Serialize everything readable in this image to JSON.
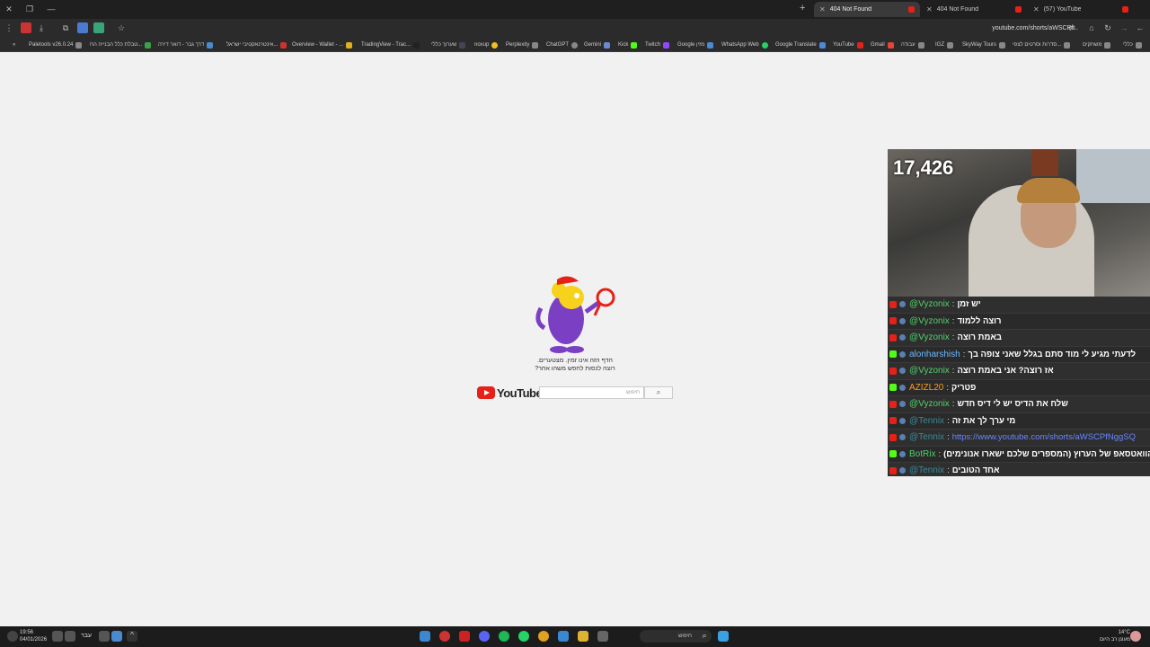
{
  "browser": {
    "tabs": [
      {
        "title": "404 Not Found",
        "active": true
      },
      {
        "title": "404 Not Found",
        "active": false
      },
      {
        "title": "(57) YouTube",
        "active": false
      }
    ],
    "url": "youtube.com/shorts/aWSCPf...",
    "bookmarks": [
      "Paletools v26.0.24",
      "טבלת כלל הבנייה הח...",
      "דרך גבר - דואר דירה",
      "אינטרנאקטיבי ישראל...",
      "Overview - Wallet - ...",
      "TradingView - Trac...",
      "שערוך כללי",
      "noxup",
      "Perplexity",
      "ChatGPT",
      "Gemini",
      "Kick",
      "Twitch",
      "Google מזין",
      "WhatsApp Web",
      "Google Translate",
      "YouTube",
      "Gmail",
      "עבודה",
      "IGZ",
      "SkyWay Tours",
      "סדרות וסרטים לצפי...",
      "משחקים",
      "כללי"
    ]
  },
  "page": {
    "error_line1": "הדף הזה אינו זמין. מצטערים.",
    "error_line2": "רוצה לנסות לחפש משהו אחר?",
    "logo_text": "YouTube",
    "search_placeholder": "חיפוש"
  },
  "stream": {
    "viewer_count": "17,426",
    "chat": [
      {
        "platform": "yt",
        "user": "@Vyzonix",
        "color": "#4fd16a",
        "text": "יש זמן"
      },
      {
        "platform": "yt",
        "user": "@Vyzonix",
        "color": "#4fd16a",
        "text": "רוצה ללמוד"
      },
      {
        "platform": "yt",
        "user": "@Vyzonix",
        "color": "#4fd16a",
        "text": "באמת רוצה"
      },
      {
        "platform": "kick",
        "user": "alonharshish",
        "color": "#6ab8ff",
        "text": "לדעתי מגיע לי מוד סתם בגלל שאני צופה בך"
      },
      {
        "platform": "yt",
        "user": "@Vyzonix",
        "color": "#4fd16a",
        "text": "אז רוצה? אני באמת רוצה"
      },
      {
        "platform": "kick",
        "user": "AZIZL20",
        "color": "#ff9c1a",
        "text": "פטריק"
      },
      {
        "platform": "yt",
        "user": "@Vyzonix",
        "color": "#4fd16a",
        "text": "שלח את הדיס יש לי דיס חדש"
      },
      {
        "platform": "yt",
        "user": "@Tennix",
        "color": "#3a8a9a",
        "text": "מי ערך לך את זה"
      },
      {
        "platform": "yt",
        "user": "@Tennix",
        "color": "#3a8a9a",
        "text": "https://www.youtube.com/shorts/aWSCPfNggSQ",
        "link": true
      },
      {
        "platform": "kick",
        "user": "BotRix",
        "color": "#4fd16a",
        "text": "הוואטסאפ של הערוץ (המספרים שלכם ישארו אנונימים)"
      },
      {
        "platform": "yt",
        "user": "@Tennix",
        "color": "#3a8a9a",
        "text": "אחד הטובים"
      }
    ]
  },
  "taskbar": {
    "time": "19:56",
    "date": "04/01/2026",
    "lang": "עבר",
    "search_label": "חיפוש",
    "temperature": "14°C",
    "weather": "מעונן רב היום"
  }
}
